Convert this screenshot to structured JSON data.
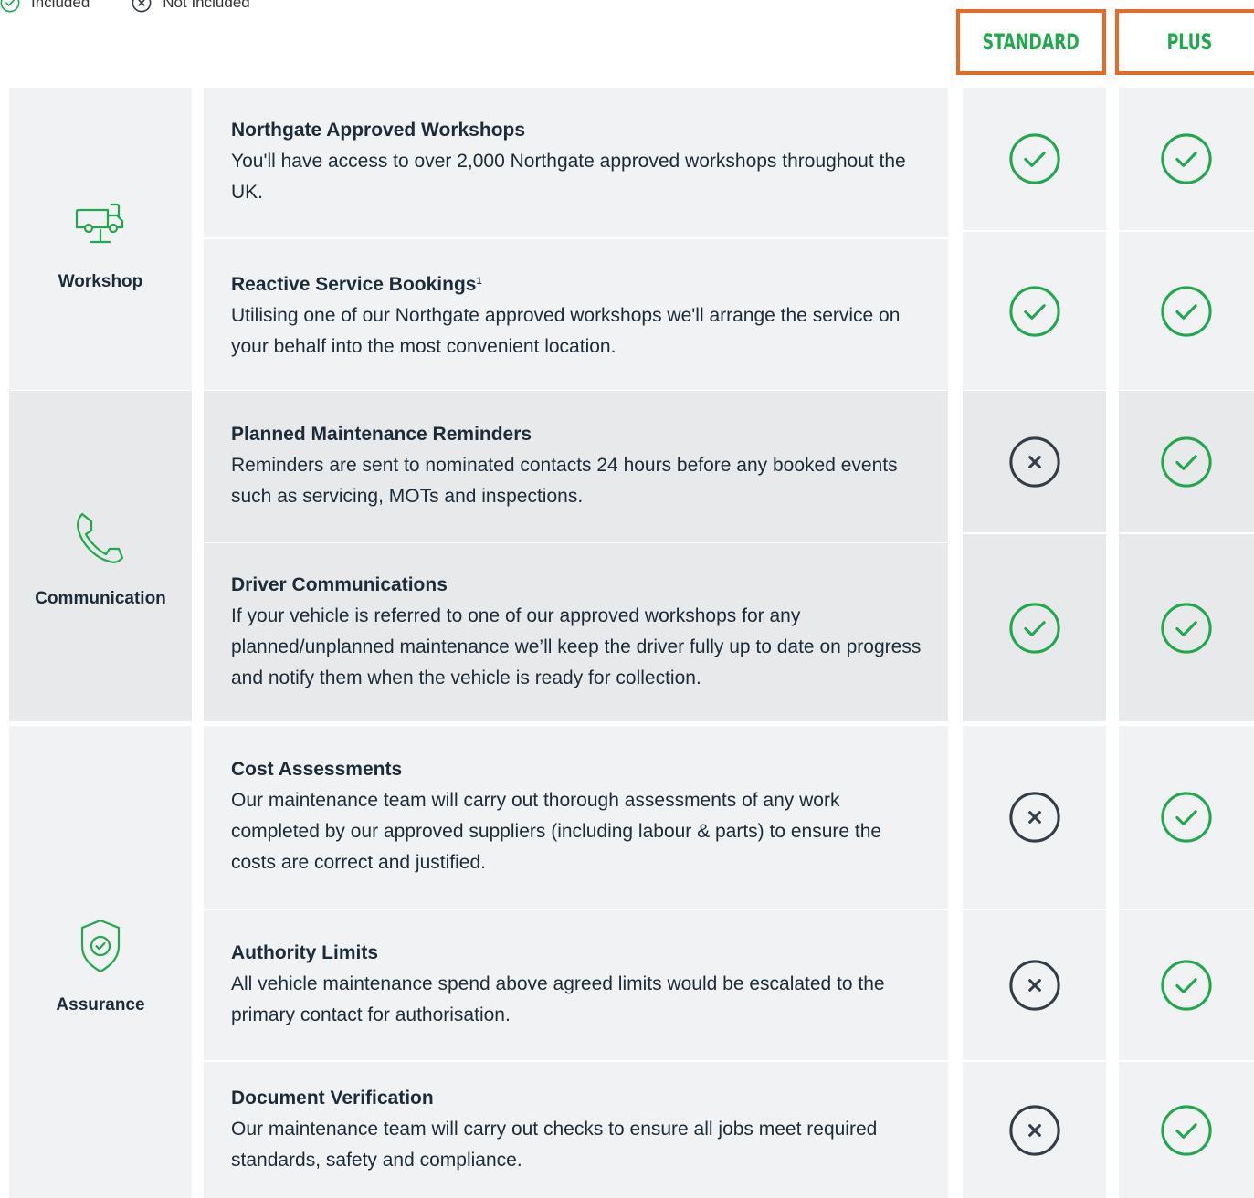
{
  "legend": {
    "included_label": "Included",
    "not_included_label": "Not Included"
  },
  "plans": {
    "standard": "STANDARD",
    "plus": "PLUS"
  },
  "colors": {
    "included": "#1fa94c",
    "not_included": "#333d47",
    "header_border": "#e46a26",
    "header_text": "#1fa94c"
  },
  "groups": [
    {
      "label": "Workshop",
      "icon": "van-on-lift-icon"
    },
    {
      "label": "Communication",
      "icon": "phone-icon"
    },
    {
      "label": "Assurance",
      "icon": "shield-check-icon"
    }
  ],
  "features": [
    {
      "title": "Northgate Approved Workshops",
      "superscript": "",
      "description": "You'll have access to over 2,000 Northgate approved workshops throughout the UK.",
      "standard": "included",
      "plus": "included"
    },
    {
      "title": "Reactive Service Bookings",
      "superscript": "1",
      "description": "Utilising one of our Northgate approved workshops we'll arrange the service on your behalf into the most convenient location.",
      "standard": "included",
      "plus": "included"
    },
    {
      "title": "Planned Maintenance Reminders",
      "superscript": "",
      "description": "Reminders are sent to nominated contacts 24 hours before any booked events such as servicing, MOTs and inspections.",
      "standard": "not_included",
      "plus": "included"
    },
    {
      "title": "Driver Communications",
      "superscript": "",
      "description": "If your vehicle is referred to one of our approved workshops for any planned/unplanned maintenance we’ll keep the driver fully up to date on progress and notify them when the vehicle is ready for collection.",
      "standard": "included",
      "plus": "included"
    },
    {
      "title": "Cost Assessments",
      "superscript": "",
      "description": "Our maintenance team will carry out thorough assessments of any work completed by our approved suppliers (including labour & parts) to ensure the costs are correct and justified.",
      "standard": "not_included",
      "plus": "included"
    },
    {
      "title": "Authority Limits",
      "superscript": "",
      "description": "All vehicle maintenance spend above agreed limits would be escalated to the primary contact for authorisation.",
      "standard": "not_included",
      "plus": "included"
    },
    {
      "title": "Document Verification",
      "superscript": "",
      "description": "Our maintenance team will carry out checks to ensure all jobs meet required standards, safety and compliance.",
      "standard": "not_included",
      "plus": "included"
    }
  ]
}
